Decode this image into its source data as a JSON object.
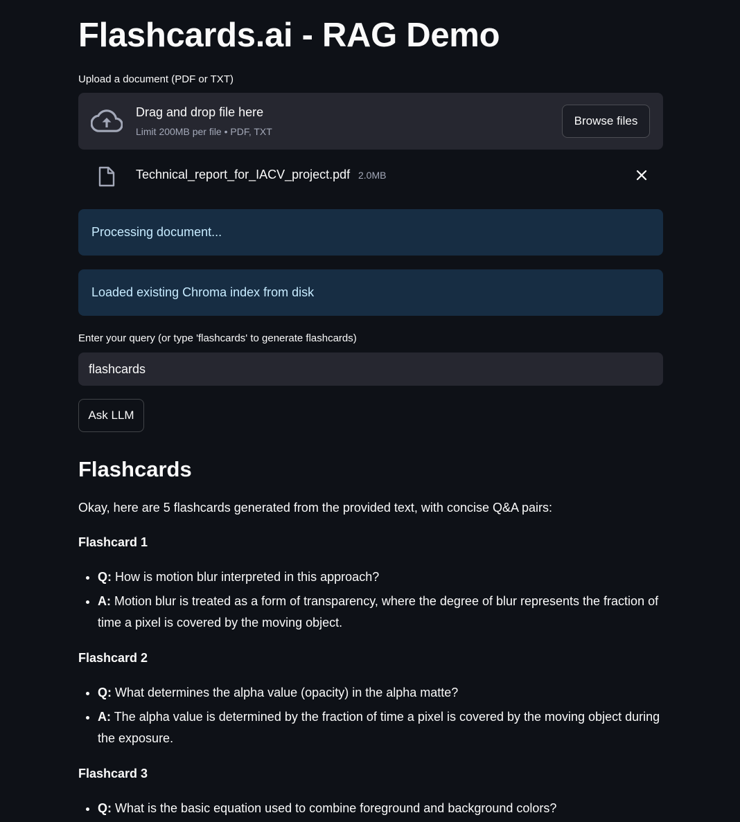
{
  "app": {
    "title": "Flashcards.ai - RAG Demo"
  },
  "uploader": {
    "label": "Upload a document (PDF or TXT)",
    "drop_text": "Drag and drop file here",
    "limit_text": "Limit 200MB per file • PDF, TXT",
    "browse_label": "Browse files",
    "file": {
      "name": "Technical_report_for_IACV_project.pdf",
      "size": "2.0MB"
    }
  },
  "alerts": {
    "processing": "Processing document...",
    "loaded": "Loaded existing Chroma index from disk"
  },
  "query": {
    "label": "Enter your query (or type 'flashcards' to generate flashcards)",
    "value": "flashcards",
    "ask_label": "Ask LLM"
  },
  "flashcards": {
    "heading": "Flashcards",
    "intro": "Okay, here are 5 flashcards generated from the provided text, with concise Q&A pairs:",
    "q_prefix": "Q:",
    "a_prefix": "A:",
    "cards": [
      {
        "title": "Flashcard 1",
        "q": "How is motion blur interpreted in this approach?",
        "a": "Motion blur is treated as a form of transparency, where the degree of blur represents the fraction of time a pixel is covered by the moving object."
      },
      {
        "title": "Flashcard 2",
        "q": "What determines the alpha value (opacity) in the alpha matte?",
        "a": "The alpha value is determined by the fraction of time a pixel is covered by the moving object during the exposure."
      },
      {
        "title": "Flashcard 3",
        "q": "What is the basic equation used to combine foreground and background colors?"
      }
    ]
  },
  "colors": {
    "background": "#0e1117",
    "surface": "#262730",
    "info_bg": "#172d43",
    "info_text": "#c7ebff",
    "muted_text": "#a3a8b8"
  },
  "icons": {
    "upload": "cloud-upload-icon",
    "file": "file-icon",
    "remove": "close-icon"
  }
}
